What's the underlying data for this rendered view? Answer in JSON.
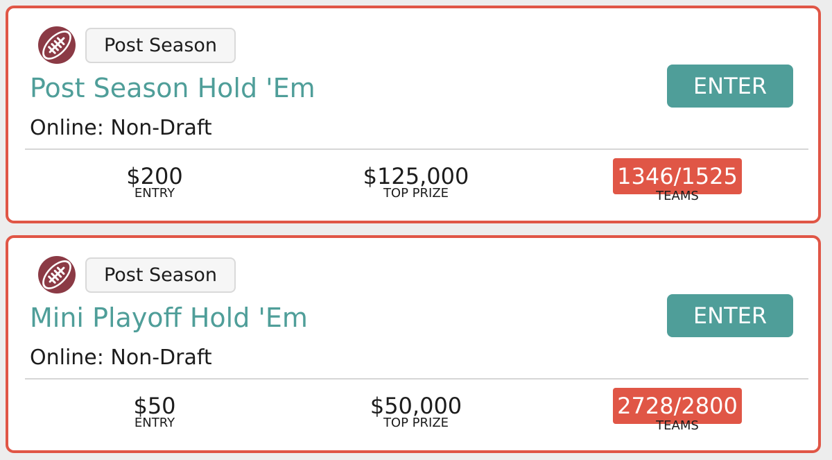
{
  "contests": [
    {
      "category_tag": "Post Season",
      "title": "Post Season Hold 'Em",
      "subtitle": "Online: Non-Draft",
      "enter_label": "ENTER",
      "entry_value": "$200",
      "entry_label": "ENTRY",
      "prize_value": "$125,000",
      "prize_label": "TOP PRIZE",
      "teams_value": "1346/1525",
      "teams_label": "TEAMS",
      "icon": "football-icon"
    },
    {
      "category_tag": "Post Season",
      "title": "Mini Playoff Hold 'Em",
      "subtitle": "Online: Non-Draft",
      "enter_label": "ENTER",
      "entry_value": "$50",
      "entry_label": "ENTRY",
      "prize_value": "$50,000",
      "prize_label": "TOP PRIZE",
      "teams_value": "2728/2800",
      "teams_label": "TEAMS",
      "icon": "football-icon"
    }
  ],
  "colors": {
    "accent_teal": "#4f9e99",
    "alert_red": "#e05646",
    "football_maroon": "#8b3a45"
  }
}
